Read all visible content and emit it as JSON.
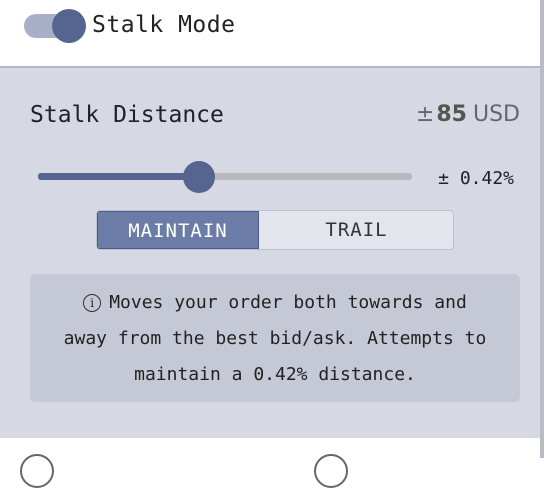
{
  "header": {
    "label": "Stalk Mode",
    "toggle_on": true
  },
  "distance": {
    "label": "Stalk Distance",
    "prefix": "±",
    "amount": "85",
    "currency": "USD",
    "slider_fraction": 0.43,
    "percent_label": "± 0.42%"
  },
  "mode": {
    "options": [
      "MAINTAIN",
      "TRAIL"
    ],
    "selected": "MAINTAIN"
  },
  "info": {
    "icon": "info-icon",
    "lines": [
      "Moves your order both towards and",
      "away from the best bid/ask. Attempts to",
      "maintain a 0.42% distance."
    ]
  },
  "colors": {
    "accent": "#55658f",
    "panel": "#d6d9e3",
    "info_bg": "#c4c9d5"
  }
}
